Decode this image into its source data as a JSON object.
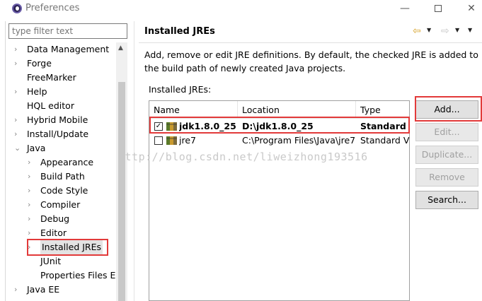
{
  "window": {
    "title": "Preferences",
    "minimize": "—",
    "close": "✕"
  },
  "filter": {
    "placeholder": "type filter text"
  },
  "tree": [
    {
      "label": "Data Management",
      "expander": "›"
    },
    {
      "label": "Forge",
      "expander": "›"
    },
    {
      "label": "FreeMarker",
      "expander": ""
    },
    {
      "label": "Help",
      "expander": "›"
    },
    {
      "label": "HQL editor",
      "expander": ""
    },
    {
      "label": "Hybrid Mobile",
      "expander": "›"
    },
    {
      "label": "Install/Update",
      "expander": "›"
    },
    {
      "label": "Java",
      "expander": "⌄"
    },
    {
      "label": "Appearance",
      "expander": "›"
    },
    {
      "label": "Build Path",
      "expander": "›"
    },
    {
      "label": "Code Style",
      "expander": "›"
    },
    {
      "label": "Compiler",
      "expander": "›"
    },
    {
      "label": "Debug",
      "expander": "›"
    },
    {
      "label": "Editor",
      "expander": "›"
    },
    {
      "label": "Installed JREs",
      "expander": "›"
    },
    {
      "label": "JUnit",
      "expander": ""
    },
    {
      "label": "Properties Files Ed",
      "expander": ""
    },
    {
      "label": "Java EE",
      "expander": "›"
    }
  ],
  "page": {
    "title": "Installed JREs",
    "description": "Add, remove or edit JRE definitions. By default, the checked JRE is added to the build path of newly created Java projects.",
    "section_label": "Installed JREs:"
  },
  "table": {
    "columns": [
      "Name",
      "Location",
      "Type"
    ],
    "rows": [
      {
        "checked": "✓",
        "name": "jdk1.8.0_25 ...",
        "location": "D:\\jdk1.8.0_25",
        "type": "Standard V"
      },
      {
        "checked": "",
        "name": "jre7",
        "location": "C:\\Program Files\\Java\\jre7",
        "type": "Standard VM"
      }
    ]
  },
  "buttons": {
    "add": "Add...",
    "edit": "Edit...",
    "duplicate": "Duplicate...",
    "remove": "Remove",
    "search": "Search..."
  },
  "watermark": "http://blog.csdn.net/liweizhong193516",
  "colors": {
    "highlight": "#e23a3a",
    "back_arrow": "#d8a531"
  }
}
